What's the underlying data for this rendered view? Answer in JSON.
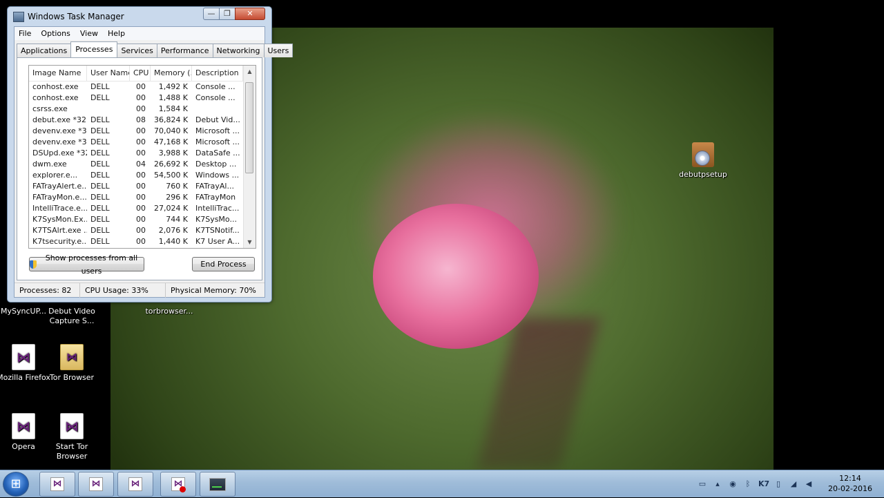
{
  "window": {
    "title": "Windows Task Manager",
    "caption_min": "—",
    "caption_max": "❐",
    "caption_close": "✕"
  },
  "menu": [
    "File",
    "Options",
    "View",
    "Help"
  ],
  "tabs": [
    "Applications",
    "Processes",
    "Services",
    "Performance",
    "Networking",
    "Users"
  ],
  "active_tab": "Processes",
  "columns": [
    "Image Name",
    "User Name",
    "CPU",
    "Memory (...",
    "Description"
  ],
  "processes": [
    {
      "name": "conhost.exe",
      "user": "DELL",
      "cpu": "00",
      "mem": "1,492 K",
      "desc": "Console ..."
    },
    {
      "name": "conhost.exe",
      "user": "DELL",
      "cpu": "00",
      "mem": "1,488 K",
      "desc": "Console ..."
    },
    {
      "name": "csrss.exe",
      "user": "",
      "cpu": "00",
      "mem": "1,584 K",
      "desc": ""
    },
    {
      "name": "debut.exe *32",
      "user": "DELL",
      "cpu": "08",
      "mem": "36,824 K",
      "desc": "Debut Vid..."
    },
    {
      "name": "devenv.exe *32",
      "user": "DELL",
      "cpu": "00",
      "mem": "70,040 K",
      "desc": "Microsoft ..."
    },
    {
      "name": "devenv.exe *32",
      "user": "DELL",
      "cpu": "00",
      "mem": "47,168 K",
      "desc": "Microsoft ..."
    },
    {
      "name": "DSUpd.exe *32",
      "user": "DELL",
      "cpu": "00",
      "mem": "3,988 K",
      "desc": "DataSafe ..."
    },
    {
      "name": "dwm.exe",
      "user": "DELL",
      "cpu": "04",
      "mem": "26,692 K",
      "desc": "Desktop ..."
    },
    {
      "name": "explorer.e...",
      "user": "DELL",
      "cpu": "00",
      "mem": "54,500 K",
      "desc": "Windows ..."
    },
    {
      "name": "FATrayAlert.e...",
      "user": "DELL",
      "cpu": "00",
      "mem": "760 K",
      "desc": "FATrayAl..."
    },
    {
      "name": "FATrayMon.e...",
      "user": "DELL",
      "cpu": "00",
      "mem": "296 K",
      "desc": "FATrayMon"
    },
    {
      "name": "IntelliTrace.e...",
      "user": "DELL",
      "cpu": "00",
      "mem": "27,024 K",
      "desc": "IntelliTrac..."
    },
    {
      "name": "K7SysMon.Ex...",
      "user": "DELL",
      "cpu": "00",
      "mem": "744 K",
      "desc": "K7SysMo..."
    },
    {
      "name": "K7TSAlrt.exe ...",
      "user": "DELL",
      "cpu": "00",
      "mem": "2,076 K",
      "desc": "K7TSNotif..."
    },
    {
      "name": "K7tsecurity.e...",
      "user": "DELL",
      "cpu": "00",
      "mem": "1,440 K",
      "desc": "K7 User A..."
    }
  ],
  "buttons": {
    "show_all": "Show processes from all users",
    "end_process": "End Process"
  },
  "status": {
    "processes": "Processes: 82",
    "cpu": "CPU Usage: 33%",
    "memory": "Physical Memory: 70%"
  },
  "desktop_icons": {
    "mysyncup": "MySyncUP...",
    "debut_video": "Debut Video Capture S...",
    "torbrowser_partial": "torbrowser...",
    "firefox": "Mozilla Firefox",
    "tor_browser": "Tor Browser",
    "opera": "Opera",
    "start_tor": "Start Tor Browser",
    "debutpsetup": "debutpsetup"
  },
  "taskbar": {
    "start_glyph": "⊞",
    "clock_time": "12:14",
    "clock_date": "20-02-2016",
    "tray_k7": "K7"
  }
}
